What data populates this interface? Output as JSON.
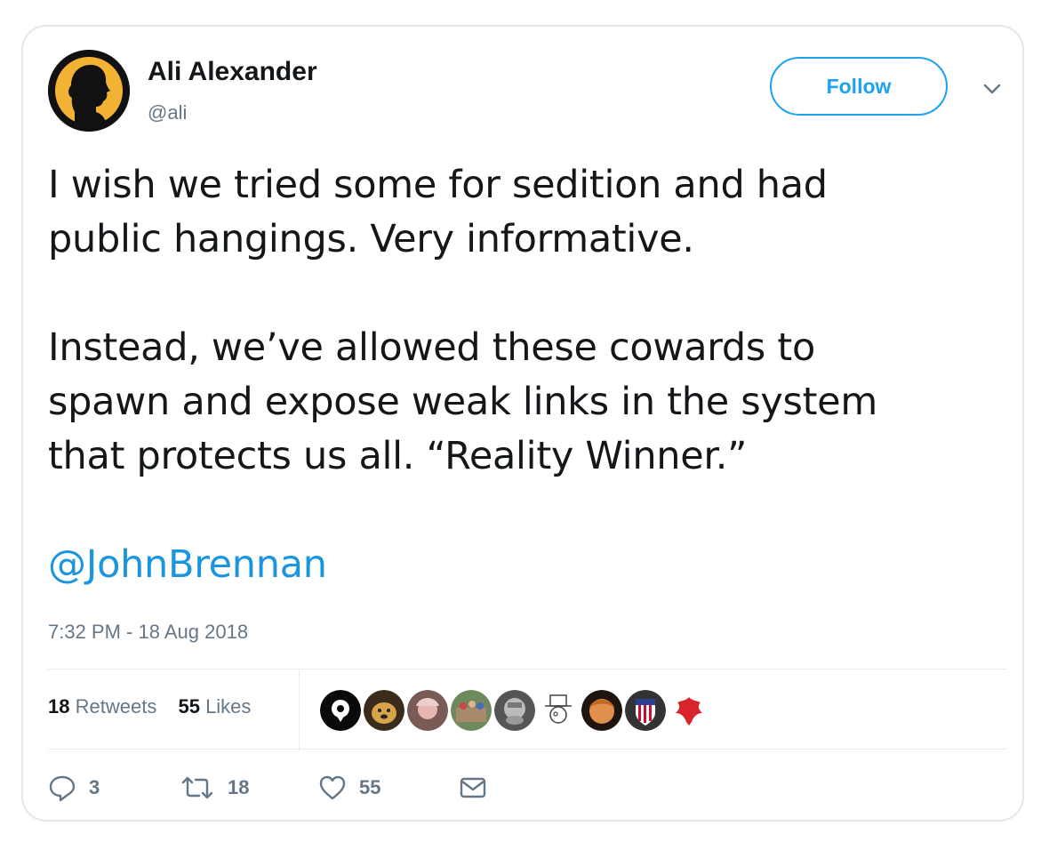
{
  "author": {
    "name": "Ali Alexander",
    "handle": "@ali"
  },
  "follow_label": "Follow",
  "tweet": {
    "lines_para1": [
      "I wish we tried some for sedition and had",
      "public hangings. Very informative."
    ],
    "lines_para2": [
      "Instead, we’ve allowed these cowards to",
      "spawn and expose weak links in the system",
      "that protects us all. “Reality Winner.”"
    ],
    "mention": "@JohnBrennan"
  },
  "timestamp": "7:32 PM - 18 Aug 2018",
  "stats": {
    "retweets_count": "18",
    "retweets_label": "Retweets",
    "likes_count": "55",
    "likes_label": "Likes"
  },
  "actions": {
    "reply_count": "3",
    "retweet_count": "18",
    "like_count": "55"
  },
  "colors": {
    "accent": "#1da1f2",
    "link": "#1b95e0",
    "muted": "#657786",
    "border": "#e1e8ed"
  },
  "icons": [
    "chevron-down-icon",
    "reply-icon",
    "retweet-icon",
    "heart-icon",
    "envelope-icon"
  ]
}
